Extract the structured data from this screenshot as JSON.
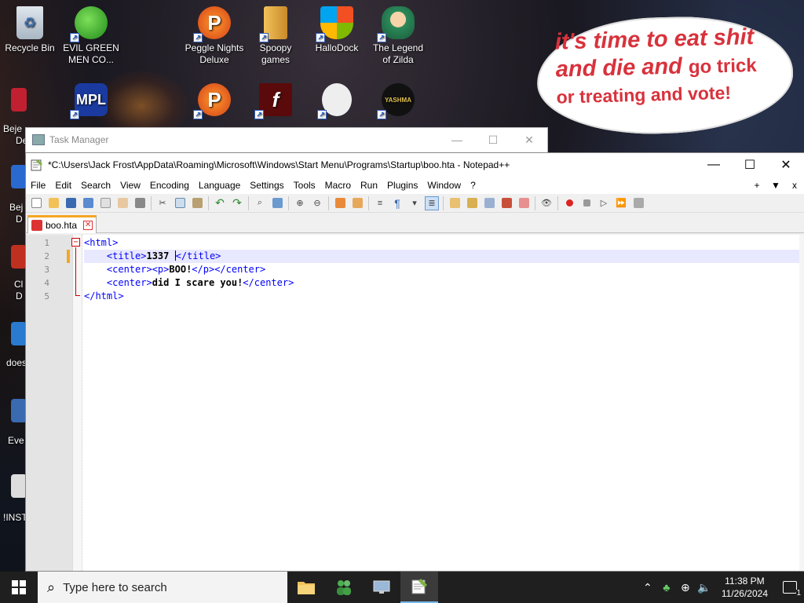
{
  "desktop": {
    "icons": [
      {
        "label": "Recycle Bin"
      },
      {
        "label": "EVIL GREEN MEN CO..."
      },
      {
        "label": "Peggle Nights Deluxe"
      },
      {
        "label": "Spoopy games"
      },
      {
        "label": "HalloDock"
      },
      {
        "label": "The Legend of Zilda"
      }
    ],
    "left_labels": [
      "Beje",
      "De",
      "Bej",
      "D",
      "Cl",
      "D",
      "does",
      "Eve",
      "!INST"
    ],
    "bubble": {
      "line1": "it's time to eat shit",
      "line2a": "and die and",
      "line2b": "go trick",
      "line3": "or treating and vote!"
    }
  },
  "taskmgr": {
    "title": "Task Manager"
  },
  "notepad": {
    "title": "*C:\\Users\\Jack Frost\\AppData\\Roaming\\Microsoft\\Windows\\Start Menu\\Programs\\Startup\\boo.hta - Notepad++",
    "menu": [
      "File",
      "Edit",
      "Search",
      "View",
      "Encoding",
      "Language",
      "Settings",
      "Tools",
      "Macro",
      "Run",
      "Plugins",
      "Window",
      "?"
    ],
    "menu_right": [
      "+",
      "▼",
      "x"
    ],
    "tab_label": "boo.hta",
    "lines": [
      {
        "num": "1",
        "pre": "",
        "tag1": "<html>",
        "text": "",
        "tag2": ""
      },
      {
        "num": "2",
        "pre": "    ",
        "tag1": "<title>",
        "text": "1337 ",
        "tag2": "</title>"
      },
      {
        "num": "3",
        "pre": "    ",
        "tag1": "<center><p>",
        "text": "BOO!",
        "tag2": "</p></center>"
      },
      {
        "num": "4",
        "pre": "    ",
        "tag1": "<center>",
        "text": "did I scare you!",
        "tag2": "</center>"
      },
      {
        "num": "5",
        "pre": "",
        "tag1": "</html>",
        "text": "",
        "tag2": ""
      }
    ]
  },
  "taskbar": {
    "search_placeholder": "Type here to search",
    "time": "11:38 PM",
    "date": "11/26/2024",
    "notif_count": "1"
  },
  "colors": {
    "bubble_text": "#d8323c",
    "tag_blue": "#0000ff",
    "tab_accent": "#f5a623"
  }
}
